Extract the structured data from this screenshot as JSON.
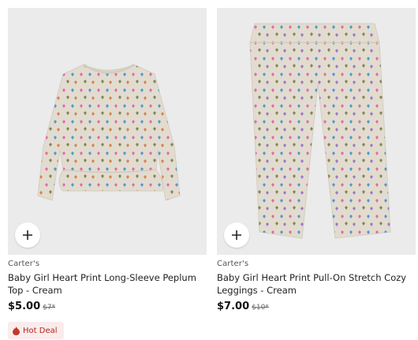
{
  "products": [
    {
      "brand": "Carter's",
      "title": "Baby Girl Heart Print Long-Sleeve Peplum Top - Cream",
      "price": "$5.00",
      "original_price": "$7*",
      "badge": "Hot Deal",
      "badge_icon": "flame-icon",
      "add_icon": "plus-icon"
    },
    {
      "brand": "Carter's",
      "title": "Baby Girl Heart Print Pull-On Stretch Cozy Leggings - Cream",
      "price": "$7.00",
      "original_price": "$10*",
      "add_icon": "plus-icon"
    }
  ],
  "colors": {
    "image_bg": "#ebebeb",
    "garment": "#e2dcd0",
    "badge_bg": "#faecec",
    "badge_text": "#b3261e",
    "hearts": [
      "#e24f9a",
      "#2c86d9",
      "#6b6f35",
      "#d96a2c",
      "#8b5ec7"
    ]
  }
}
